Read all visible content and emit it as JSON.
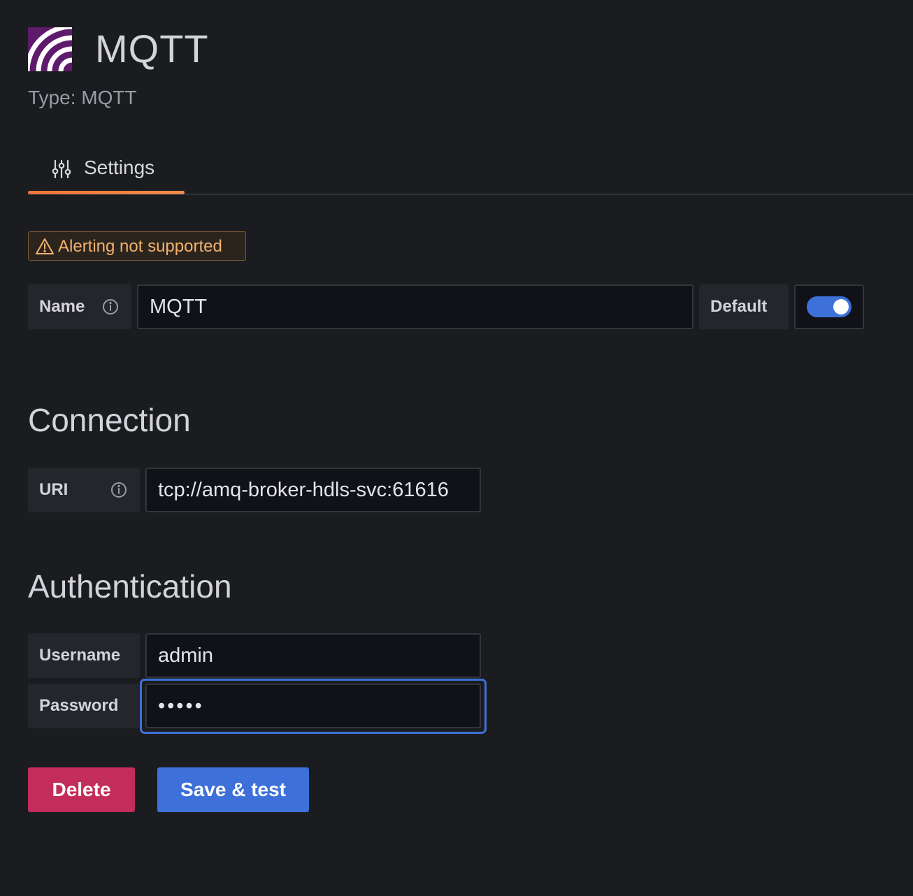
{
  "header": {
    "title": "MQTT",
    "subtitle": "Type: MQTT",
    "logo_icon": "mqtt-logo"
  },
  "tabs": [
    {
      "label": "Settings",
      "icon": "sliders-icon",
      "active": true
    }
  ],
  "alert_badge": {
    "icon": "warning-triangle-icon",
    "text": "Alerting not supported"
  },
  "name_field": {
    "label": "Name",
    "value": "MQTT",
    "info_icon": "info-icon"
  },
  "default_field": {
    "label": "Default",
    "enabled": true
  },
  "connection": {
    "heading": "Connection",
    "uri_label": "URI",
    "uri_value": "tcp://amq-broker-hdls-svc:61616"
  },
  "authentication": {
    "heading": "Authentication",
    "username_label": "Username",
    "username_value": "admin",
    "password_label": "Password",
    "password_value": "•••••"
  },
  "buttons": {
    "delete_label": "Delete",
    "save_label": "Save & test"
  },
  "colors": {
    "background": "#1b1c20",
    "accent_blue": "#3d71d9",
    "delete_red": "#c32d5c",
    "tab_underline": "#f0743b",
    "warning": "#f2b26e",
    "logo_purple": "#5e1a6b"
  }
}
